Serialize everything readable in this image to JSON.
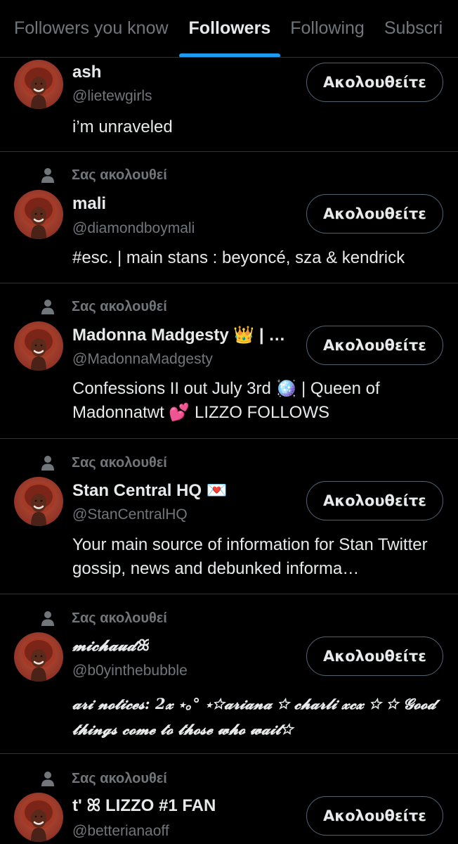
{
  "tabs": [
    {
      "label": "Followers you know"
    },
    {
      "label": "Followers"
    },
    {
      "label": "Following"
    },
    {
      "label": "Subscri"
    }
  ],
  "follows_you_label": "Σας ακολουθεί",
  "follow_button_label": "Ακολουθείτε",
  "users": [
    {
      "name": "ash",
      "handle": "@lietewgirls",
      "bio": "i’m unraveled"
    },
    {
      "name": "mali",
      "handle": "@diamondboymali",
      "bio": "#esc. | main stans : beyoncé, sza & kendrick"
    },
    {
      "name": "Madonna Madgesty 👑 | …",
      "handle": "@MadonnaMadgesty",
      "bio": "Confessions II out July 3rd 🪩 | Queen of Madonnatwt 💕 LIZZO FOLLOWS"
    },
    {
      "name": "Stan Central HQ 💌",
      "handle": "@StanCentralHQ",
      "bio": "Your main source of information for Stan Twitter gossip, news and debunked informa…"
    },
    {
      "name": "𝓶𝓲𝓬𝓱𝓪𝓾𝓭ꕤ",
      "handle": "@b0yinthebubble",
      "bio": "𝓪𝓻𝓲 𝓷𝓸𝓽𝓲𝓬𝓮𝓼: 2𝔁 ⋆｡° ⋆☆𝓪𝓻𝓲𝓪𝓷𝓪 ☆ 𝓬𝓱𝓪𝓻𝓵𝓲 𝔁𝓬𝔁 ☆ ☆ 𝓖𝓸𝓸𝓭 𝓽𝓱𝓲𝓷𝓰𝓼 𝓬𝓸𝓶𝓮 𝓽𝓸 𝓽𝓱𝓸𝓼𝓮 𝔀𝓱𝓸 𝔀𝓪𝓲𝓽☆"
    },
    {
      "name": "t' ꕤ LIZZO #1 FAN",
      "handle": "@betterianaoff",
      "bio": ""
    }
  ],
  "colors": {
    "accent": "#1d9bf0",
    "background": "#000000",
    "muted": "#71767b",
    "divider": "#2f3336"
  }
}
